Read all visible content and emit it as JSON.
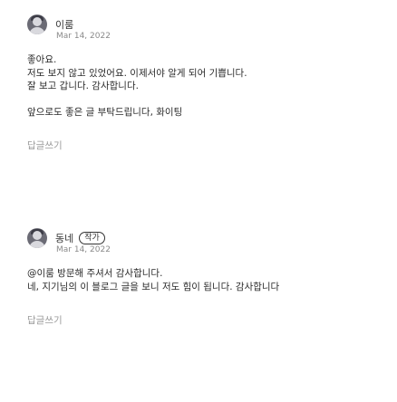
{
  "comments": [
    {
      "author": "이룸",
      "badge": "",
      "date": "Mar 14, 2022",
      "body": "좋아요.\n저도 보지 않고 있었어요. 이제서야 알게 되어 기쁩니다.\n잘 보고 갑니다. 감사합니다.",
      "tail": "앞으로도 좋은 글 부탁드립니다, 화이팅",
      "reply_label": "답글쓰기"
    },
    {
      "author": "동네",
      "badge": "작가",
      "date": "Mar 14, 2022",
      "body": "@이룸 방문해 주셔서 감사합니다.\n네, 지기님의 이 블로그 글을 보니 저도 힘이 됩니다. 감사합니다",
      "reply_label": "답글쓰기"
    }
  ]
}
